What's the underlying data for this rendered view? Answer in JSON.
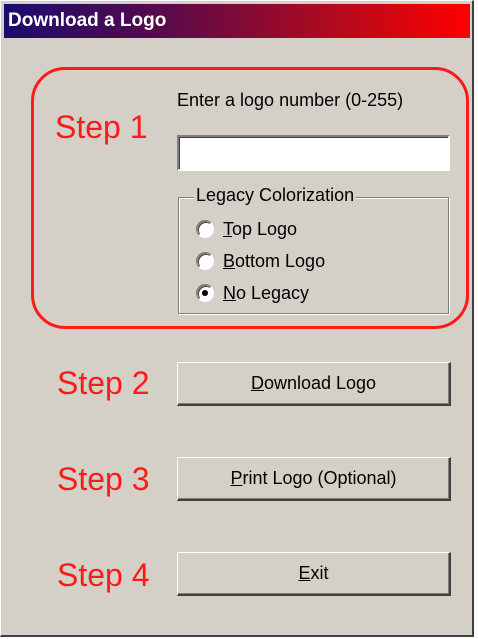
{
  "window": {
    "title": "Download a Logo"
  },
  "steps": {
    "step1": "Step 1",
    "step2": "Step 2",
    "step3": "Step 3",
    "step4": "Step 4"
  },
  "logo_input": {
    "prompt": "Enter a logo number (0-255)",
    "value": ""
  },
  "legacy": {
    "legend": "Legacy Colorization",
    "options": [
      {
        "mnemonic": "T",
        "rest": "op Logo",
        "checked": false
      },
      {
        "mnemonic": "B",
        "rest": "ottom Logo",
        "checked": false
      },
      {
        "mnemonic": "N",
        "rest": "o Legacy",
        "checked": true
      }
    ]
  },
  "buttons": {
    "download": {
      "mnemonic": "D",
      "rest": "ownload Logo"
    },
    "print": {
      "mnemonic": "P",
      "rest": "rint Logo (Optional)"
    },
    "exit": {
      "mnemonic": "E",
      "rest": "xit"
    }
  },
  "colors": {
    "accent": "#ff1a1a",
    "face": "#d4d0c8",
    "title_start": "#1a0c6e",
    "title_end": "#ff0000"
  }
}
